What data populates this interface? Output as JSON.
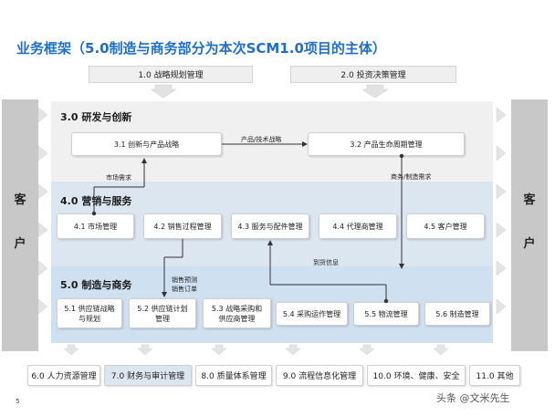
{
  "title": "业务框架（5.0制造与商务部分为本次SCM1.0项目的主体）",
  "top_boxes": [
    "1.0 战略规划管理",
    "2.0 投资决策管理"
  ],
  "customer_label": [
    "客",
    "户"
  ],
  "sections": {
    "rd": {
      "title": "3.0 研发与创新",
      "boxes": [
        "3.1 创新与产品战略",
        "3.2 产品生命周期管理"
      ]
    },
    "marketing": {
      "title": "4.0 营销与服务",
      "boxes": [
        "4.1 市场管理",
        "4.2 销售过程管理",
        "4.3 服务与配件管理",
        "4.4 代理商管理",
        "4.5 客户管理"
      ]
    },
    "manufacturing": {
      "title": "5.0 制造与商务",
      "boxes": [
        [
          "5.1 供应链战略",
          "与规划"
        ],
        [
          "5.2 供应链计划",
          "管理"
        ],
        [
          "5.3 战略采购和",
          "供应商管理"
        ],
        [
          "5.4 采购运作管理"
        ],
        [
          "5.5 物流管理"
        ],
        [
          "5.6 制造管理"
        ]
      ]
    }
  },
  "flows": {
    "product_tech": "产品/技术战略",
    "market_demand": "市场需求",
    "biz_demand": "商务/制造需求",
    "sales_forecast": "销售预测",
    "sales_order": "销售订单",
    "arrival_info": "到货信息"
  },
  "bottom_boxes": [
    "6.0 人力资源管理",
    "7.0 财务与审计管理",
    "8.0 质量体系管理",
    "9.0 流程信息化管理",
    "10.0 环境、健康、安全",
    "11.0 其他"
  ],
  "page_number": "5",
  "watermark": "头条 @文米先生",
  "colors": {
    "accent": "#1f6fc8",
    "highlight_box": "#dce6f1",
    "band_mid": "#dce6f1",
    "band_bot": "#cfe0f1"
  }
}
